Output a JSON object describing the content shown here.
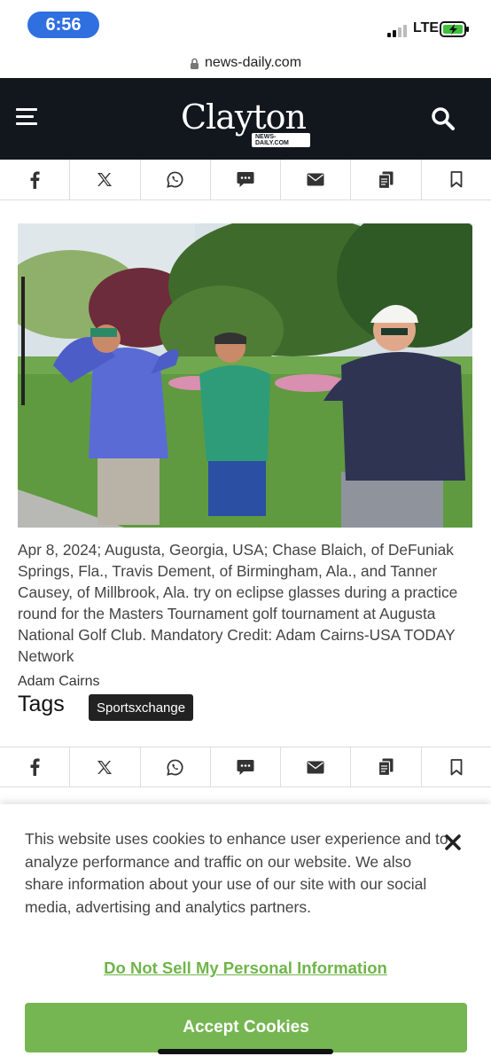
{
  "status": {
    "time": "6:56",
    "network": "LTE"
  },
  "browser": {
    "url": "news-daily.com"
  },
  "header": {
    "logo_text": "Clayton",
    "logo_badge": "NEWS-DAILY.COM",
    "colors": {
      "background": "#12171e"
    }
  },
  "share_icons": [
    "facebook-icon",
    "x-icon",
    "whatsapp-icon",
    "sms-icon",
    "email-icon",
    "copy-link-icon",
    "bookmark-icon"
  ],
  "article": {
    "caption": "Apr 8, 2024; Augusta, Georgia, USA; Chase Blaich, of DeFuniak Springs, Fla., Travis Dement, of Birmingham, Ala., and Tanner Causey, of Millbrook, Ala. try on eclipse glasses during a practice round for the Masters Tournament golf tournament at Augusta National Golf Club. Mandatory Credit: Adam Cairns-USA TODAY Network",
    "author": "Adam Cairns",
    "tags_label": "Tags",
    "tags": [
      "Sportsxchange"
    ]
  },
  "cookie_banner": {
    "text": "This website uses cookies to enhance user experience and to analyze performance and traffic on our website. We also share information about your use of our site with our social media, advertising and analytics partners.",
    "do_not_sell_label": "Do Not Sell My Personal Information",
    "accept_label": "Accept Cookies",
    "accent_color": "#76b652"
  }
}
